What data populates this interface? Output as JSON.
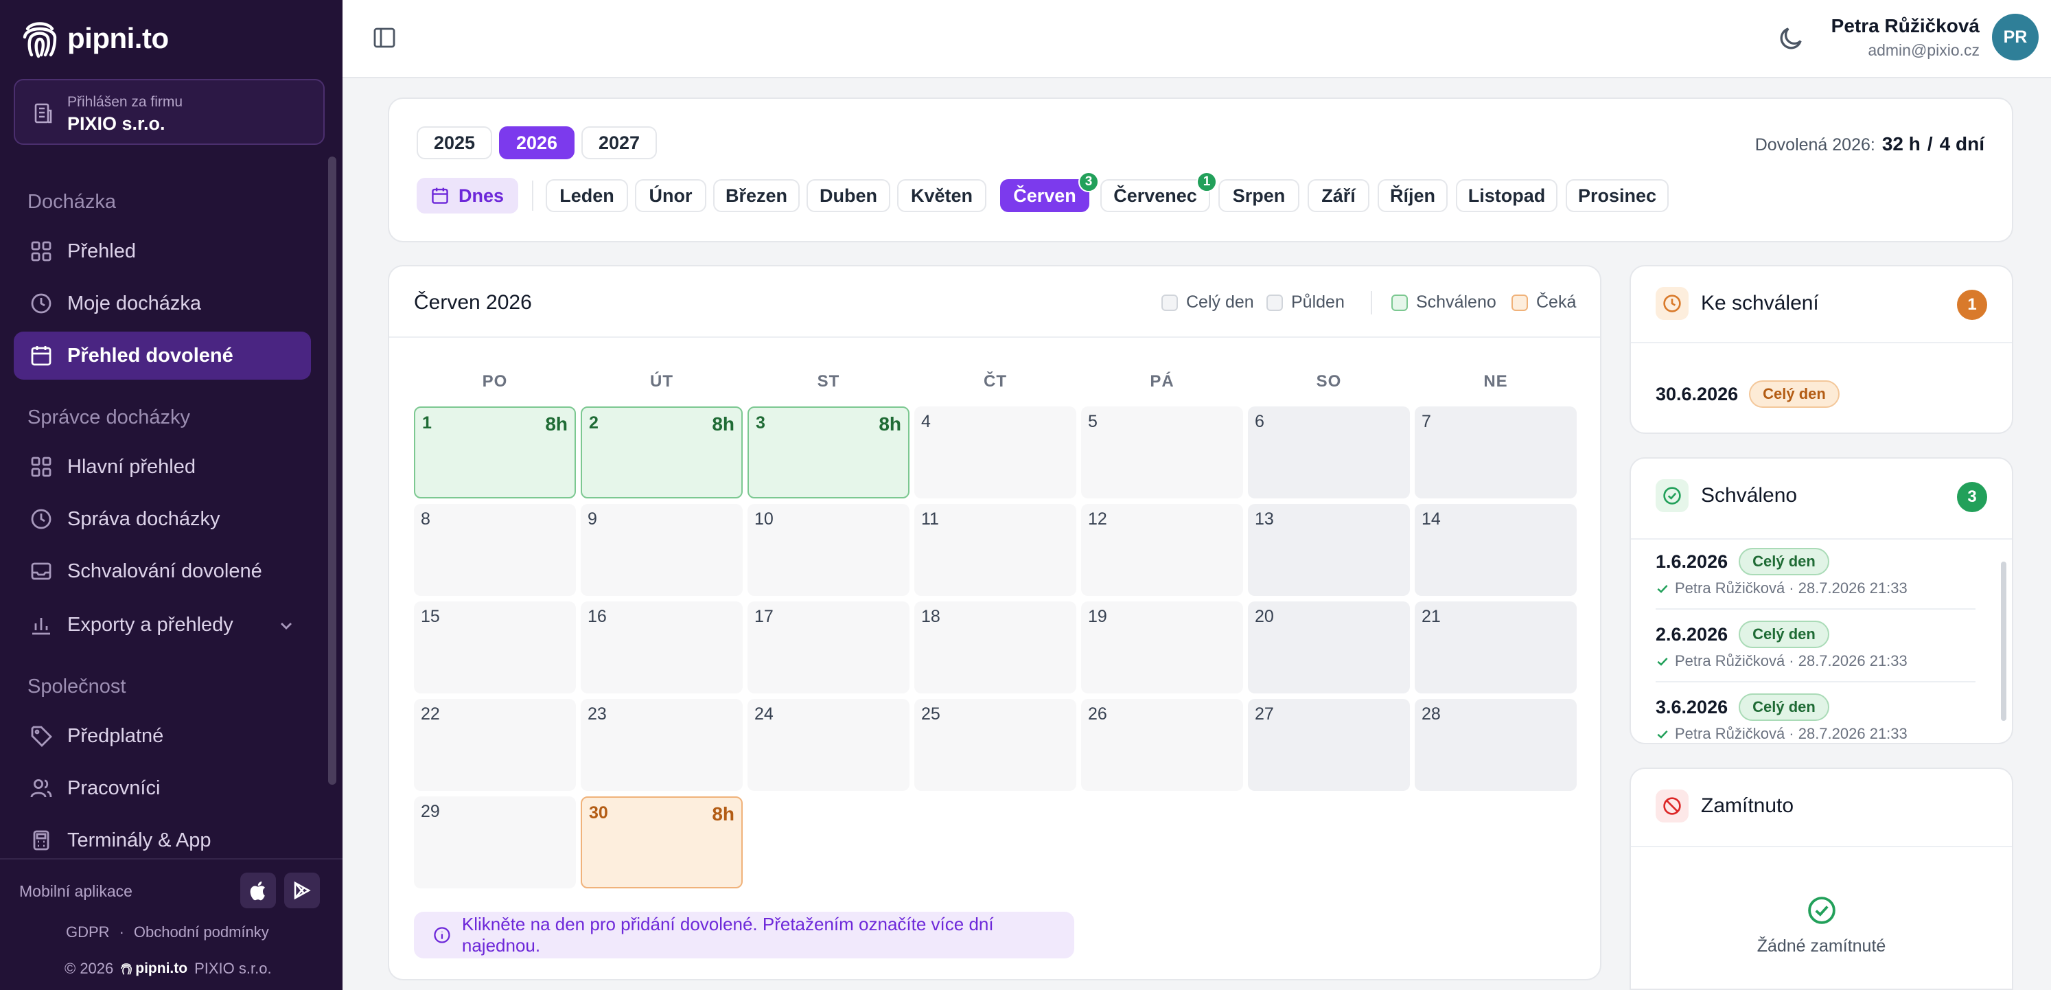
{
  "brand": {
    "name": "pipni.to"
  },
  "firm": {
    "label": "Přihlášen za firmu",
    "name": "PIXIO s.r.o."
  },
  "nav": {
    "section_attendance": "Docházka",
    "overview": "Přehled",
    "my_attendance": "Moje docházka",
    "vacation_overview": "Přehled dovolené",
    "section_admin": "Správce docházky",
    "main_overview": "Hlavní přehled",
    "attendance_mgmt": "Správa docházky",
    "vacation_approval": "Schvalování dovolené",
    "exports": "Exporty a přehledy",
    "section_company": "Společnost",
    "subscription": "Předplatné",
    "employees": "Pracovníci",
    "terminals": "Terminály & App"
  },
  "footer": {
    "mobile_label": "Mobilní aplikace",
    "gdpr": "GDPR",
    "dot": "·",
    "terms": "Obchodní podmínky",
    "copyright_prefix": "© 2026",
    "brand": "pipni.to",
    "company": "PIXIO s.r.o."
  },
  "user": {
    "name": "Petra Růžičková",
    "email": "admin@pixio.cz",
    "initials": "PR"
  },
  "years": [
    "2025",
    "2026",
    "2027"
  ],
  "today_label": "Dnes",
  "months": [
    "Leden",
    "Únor",
    "Březen",
    "Duben",
    "Květen",
    "Červen",
    "Červenec",
    "Srpen",
    "Září",
    "Říjen",
    "Listopad",
    "Prosinec"
  ],
  "month_badges": {
    "cerven": "3",
    "cervenec": "1"
  },
  "vacation_summary": {
    "label": "Dovolená 2026:",
    "hours": "32 h",
    "sep": "/",
    "days": "4 dní"
  },
  "calendar": {
    "title": "Červen 2026",
    "legend": {
      "full_day": "Celý den",
      "half_day": "Půlden",
      "approved": "Schváleno",
      "pending": "Čeká"
    },
    "weekdays": [
      "PO",
      "ÚT",
      "ST",
      "ČT",
      "PÁ",
      "SO",
      "NE"
    ],
    "hours_label": "8h",
    "info": "Klikněte na den pro přidání dovolené. Přetažením označíte více dní najednou."
  },
  "pending_panel": {
    "title": "Ke schválení",
    "count": "1",
    "date": "30.6.2026",
    "type": "Celý den"
  },
  "approved_panel": {
    "title": "Schváleno",
    "count": "3",
    "items": [
      {
        "date": "1.6.2026",
        "type": "Celý den",
        "meta": "Petra Růžičková · 28.7.2026 21:33"
      },
      {
        "date": "2.6.2026",
        "type": "Celý den",
        "meta": "Petra Růžičková · 28.7.2026 21:33"
      },
      {
        "date": "3.6.2026",
        "type": "Celý den",
        "meta": "Petra Růžičková · 28.7.2026 21:33"
      }
    ]
  },
  "rejected_panel": {
    "title": "Zamítnuto",
    "empty": "Žádné zamítnuté"
  }
}
